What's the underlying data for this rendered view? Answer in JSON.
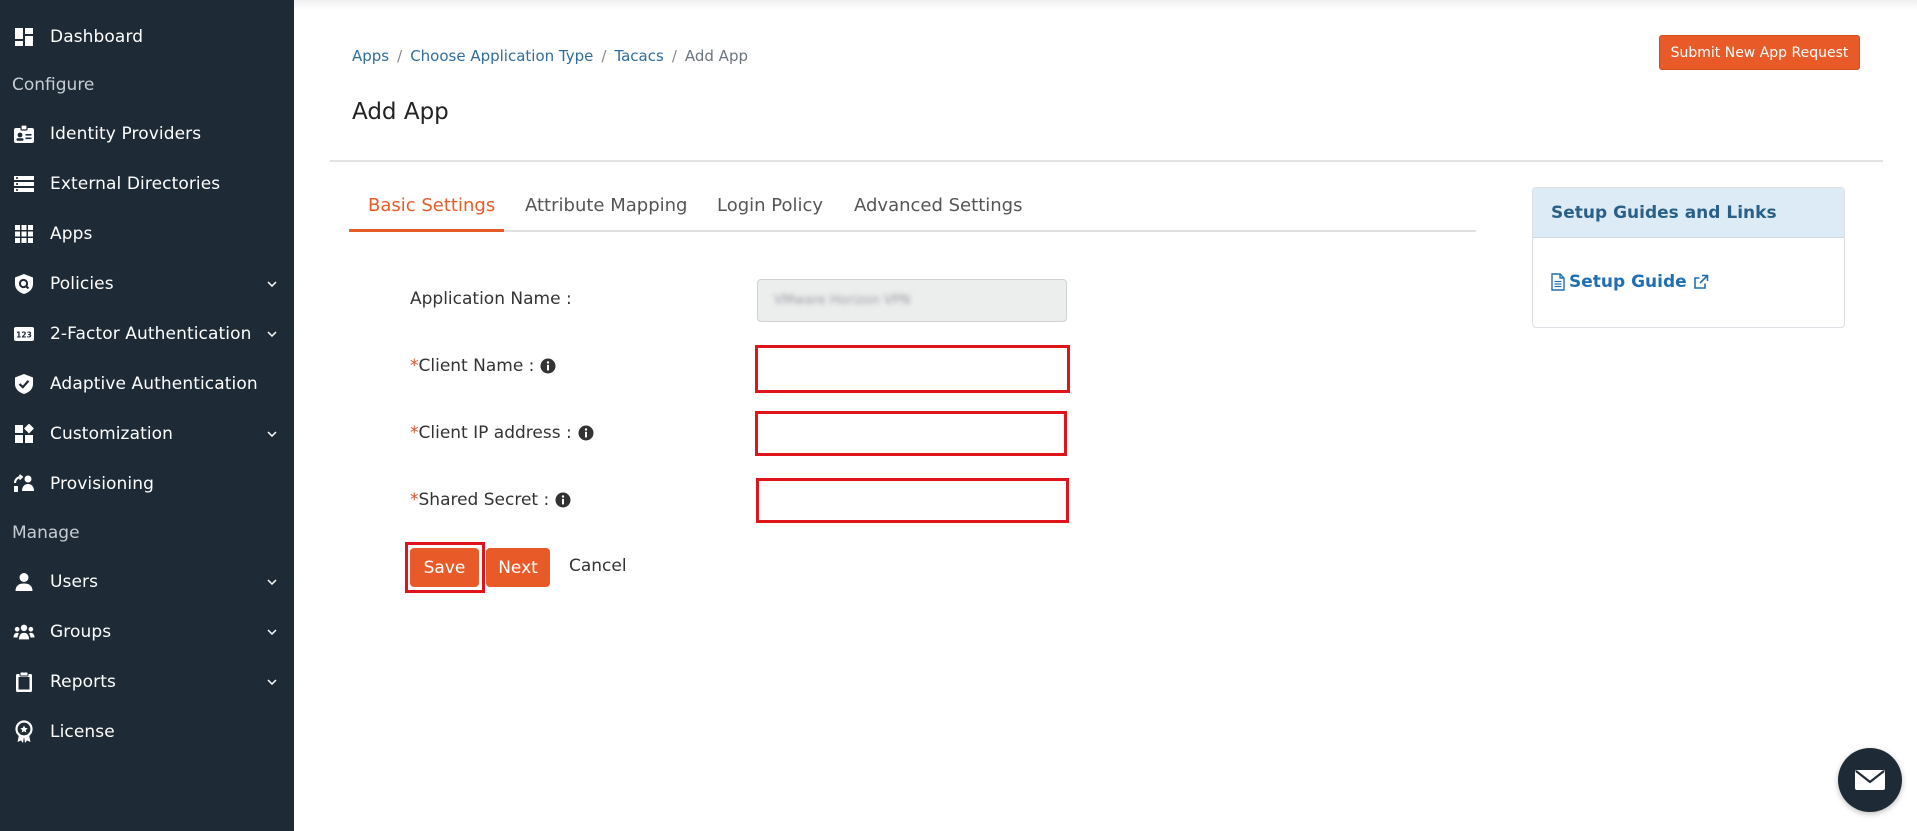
{
  "sidebar": {
    "items": [
      {
        "label": "Dashboard",
        "icon": "dashboard-icon"
      },
      {
        "label": "Identity Providers",
        "icon": "id-card-icon"
      },
      {
        "label": "External Directories",
        "icon": "directory-icon"
      },
      {
        "label": "Apps",
        "icon": "apps-grid-icon"
      },
      {
        "label": "Policies",
        "icon": "policy-shield-icon"
      },
      {
        "label": "2-Factor Authentication",
        "icon": "2fa-icon"
      },
      {
        "label": "Adaptive Authentication",
        "icon": "shield-check-icon"
      },
      {
        "label": "Customization",
        "icon": "customization-icon"
      },
      {
        "label": "Provisioning",
        "icon": "provisioning-icon"
      },
      {
        "label": "Users",
        "icon": "user-icon"
      },
      {
        "label": "Groups",
        "icon": "groups-icon"
      },
      {
        "label": "Reports",
        "icon": "clipboard-icon"
      },
      {
        "label": "License",
        "icon": "license-badge-icon"
      }
    ],
    "sections": {
      "configure": "Configure",
      "manage": "Manage"
    }
  },
  "breadcrumb": {
    "items": [
      "Apps",
      "Choose Application Type",
      "Tacacs"
    ],
    "current": "Add App",
    "separator": "/"
  },
  "header": {
    "submit_button": "Submit New App Request"
  },
  "page": {
    "title": "Add App"
  },
  "tabs": [
    {
      "label": "Basic Settings",
      "active": true
    },
    {
      "label": "Attribute Mapping",
      "active": false
    },
    {
      "label": "Login Policy",
      "active": false
    },
    {
      "label": "Advanced Settings",
      "active": false
    }
  ],
  "form": {
    "application_name_label": "Application Name :",
    "application_name_value": "VMware Horizon VPN",
    "required_marker": "*",
    "client_name_label": "Client Name :",
    "client_ip_label": "Client IP address :",
    "shared_secret_label": "Shared Secret :",
    "client_name_value": "",
    "client_ip_value": "",
    "shared_secret_value": ""
  },
  "actions": {
    "save": "Save",
    "next": "Next",
    "cancel": "Cancel"
  },
  "guide": {
    "heading": "Setup Guides and Links",
    "link": "Setup Guide"
  },
  "colors": {
    "accent": "#e95a29",
    "sidebar_bg": "#1e2a35",
    "highlight_border": "#e0141b",
    "link": "#1f6fb2"
  }
}
